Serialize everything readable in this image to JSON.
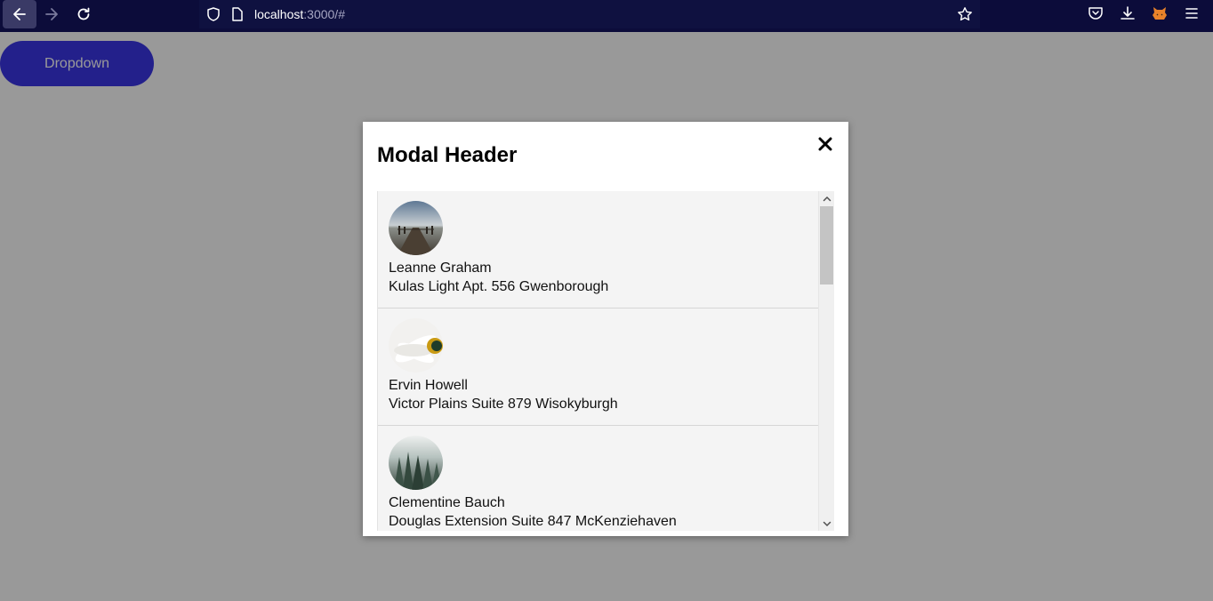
{
  "browser": {
    "url_host": "localhost",
    "url_rest": ":3000/#",
    "icons": [
      "back-icon",
      "forward-icon",
      "reload-icon",
      "shield-icon",
      "page-icon",
      "bookmark-star-icon",
      "pocket-icon",
      "download-icon",
      "extension-fox-icon",
      "menu-icon"
    ]
  },
  "page": {
    "dropdown_label": "Dropdown",
    "accent": "#3b36e8"
  },
  "modal": {
    "title": "Modal Header",
    "close_glyph": "✕",
    "users": [
      {
        "name": "Leanne Graham",
        "address": "Kulas Light Apt. 556 Gwenborough",
        "avatar": "pier-photo"
      },
      {
        "name": "Ervin Howell",
        "address": "Victor Plains Suite 879 Wisokyburgh",
        "avatar": "daisy-photo"
      },
      {
        "name": "Clementine Bauch",
        "address": "Douglas Extension Suite 847 McKenziehaven",
        "avatar": "forest-photo"
      }
    ]
  }
}
